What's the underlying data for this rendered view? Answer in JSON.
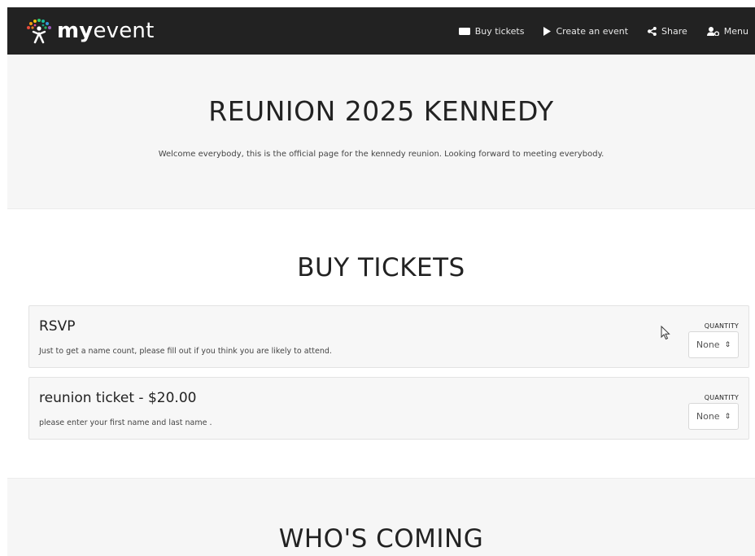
{
  "brand": {
    "bold": "my",
    "regular": "event"
  },
  "nav": [
    {
      "label": "Buy tickets",
      "icon": "ticket-icon"
    },
    {
      "label": "Create an event",
      "icon": "play-icon"
    },
    {
      "label": "Share",
      "icon": "share-icon"
    },
    {
      "label": "Menu",
      "icon": "user-gear-icon"
    }
  ],
  "event": {
    "title": "REUNION 2025 KENNEDY",
    "description": "Welcome everybody, this is the official page for the kennedy reunion. Looking forward to meeting everybody."
  },
  "tickets_section": {
    "title": "BUY TICKETS",
    "quantity_label": "QUANTITY",
    "tickets": [
      {
        "name": "RSVP",
        "price": "",
        "description": "Just to get a name count, please fill out if you think you are likely to attend.",
        "quantity": "None"
      },
      {
        "name": "reunion ticket",
        "price": " - $20.00",
        "description": "please enter your first name and last name .",
        "quantity": "None"
      }
    ]
  },
  "coming_section": {
    "title": "WHO'S COMING"
  },
  "colors": {
    "navbar": "#222222",
    "hero": "#f6f6f6",
    "card": "#f7f7f7"
  }
}
